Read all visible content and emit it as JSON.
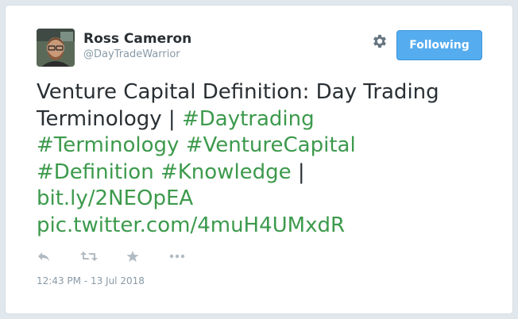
{
  "author": {
    "name": "Ross Cameron",
    "handle": "@DayTradeWarrior"
  },
  "header": {
    "follow_label": "Following",
    "settings_icon": "gear-icon"
  },
  "tweet": {
    "text_plain": "Venture Capital Definition: Day Trading Terminology | ",
    "hashtags": [
      "#Daytrading",
      "#Terminology",
      "#VentureCapital",
      "#Definition",
      "#Knowledge"
    ],
    "separator": " |",
    "short_link": "bit.ly/2NEOpEA",
    "pic_link": "pic.twitter.com/4muH4UMxdR"
  },
  "actions": {
    "icons": [
      "reply-icon",
      "retweet-icon",
      "favorite-icon",
      "more-icon"
    ]
  },
  "timestamp": "12:43 PM - 13 Jul 2018",
  "colors": {
    "link": "#3c9a4c",
    "button": "#55acee",
    "text": "#292f33",
    "muted": "#8899a6"
  }
}
